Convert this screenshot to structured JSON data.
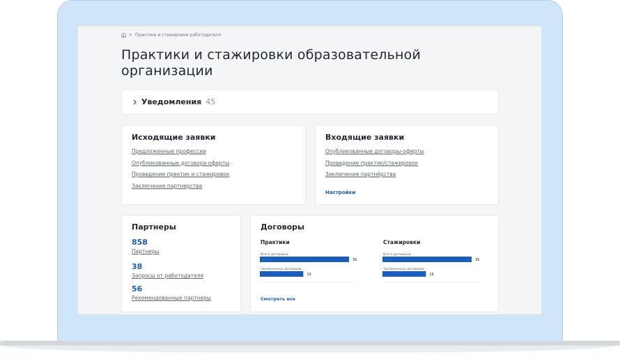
{
  "breadcrumb": {
    "home_icon": "home-icon",
    "separator": ">",
    "current": "Практики и стажировки работодателя"
  },
  "page_title": "Практики и стажировки образовательной организации",
  "notifications": {
    "label": "Уведомления",
    "count": "45"
  },
  "outgoing": {
    "title": "Исходящие заявки",
    "links": [
      "Предложенные профессии",
      "Опубликованные договора-оферты",
      "Проведение практик и стажировок",
      "Заключение партнерства"
    ]
  },
  "incoming": {
    "title": "Входящие заявки",
    "links": [
      "Опубликованные договоры-оферты",
      "Проведение практик/стажировок",
      "Заключение партнёрства"
    ],
    "settings": "Настройки"
  },
  "partners": {
    "title": "Партнеры",
    "stats": [
      {
        "value": "858",
        "label": "Партнеры"
      },
      {
        "value": "38",
        "label": "Запросы от работодателя"
      },
      {
        "value": "56",
        "label": "Рекомендованные партнеры"
      }
    ]
  },
  "contracts": {
    "title": "Договоры",
    "see_all": "Смотреть все"
  },
  "colors": {
    "accent": "#1a5fbf",
    "lid": "#cfe6fa",
    "screen_bg": "#f4f5f6"
  },
  "chart_data": [
    {
      "type": "bar",
      "title": "Практики",
      "categories": [
        "Всего договоров",
        "Заключенных договоров"
      ],
      "values": [
        39,
        19
      ],
      "xlim": [
        0,
        39
      ]
    },
    {
      "type": "bar",
      "title": "Стажировки",
      "categories": [
        "Всего договоров",
        "Заключенных договоров"
      ],
      "values": [
        39,
        19
      ],
      "xlim": [
        0,
        39
      ]
    }
  ]
}
